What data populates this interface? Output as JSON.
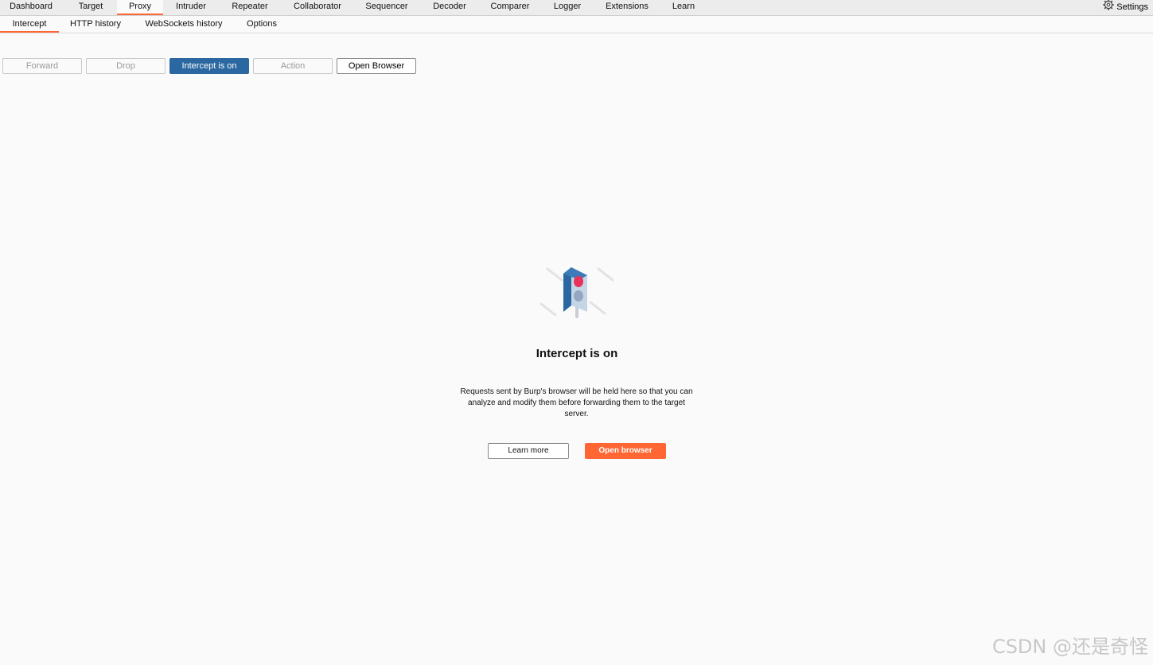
{
  "top_tabs": [
    "Dashboard",
    "Target",
    "Proxy",
    "Intruder",
    "Repeater",
    "Collaborator",
    "Sequencer",
    "Decoder",
    "Comparer",
    "Logger",
    "Extensions",
    "Learn"
  ],
  "active_top_tab": "Proxy",
  "settings_label": "Settings",
  "sub_tabs": [
    "Intercept",
    "HTTP history",
    "WebSockets history",
    "Options"
  ],
  "active_sub_tab": "Intercept",
  "toolbar": {
    "forward": "Forward",
    "drop": "Drop",
    "intercept": "Intercept is on",
    "action": "Action",
    "open_browser": "Open Browser"
  },
  "empty_state": {
    "title": "Intercept is on",
    "description": "Requests sent by Burp's browser will be held here so that you can analyze and modify them before forwarding them to the target server.",
    "learn_more": "Learn more",
    "open_browser": "Open browser",
    "illustration": "traffic-light-icon"
  },
  "watermark": "CSDN @还是奇怪",
  "colors": {
    "accent": "#ff6633",
    "primary_blue": "#2b67a0",
    "background": "#fafafa"
  }
}
